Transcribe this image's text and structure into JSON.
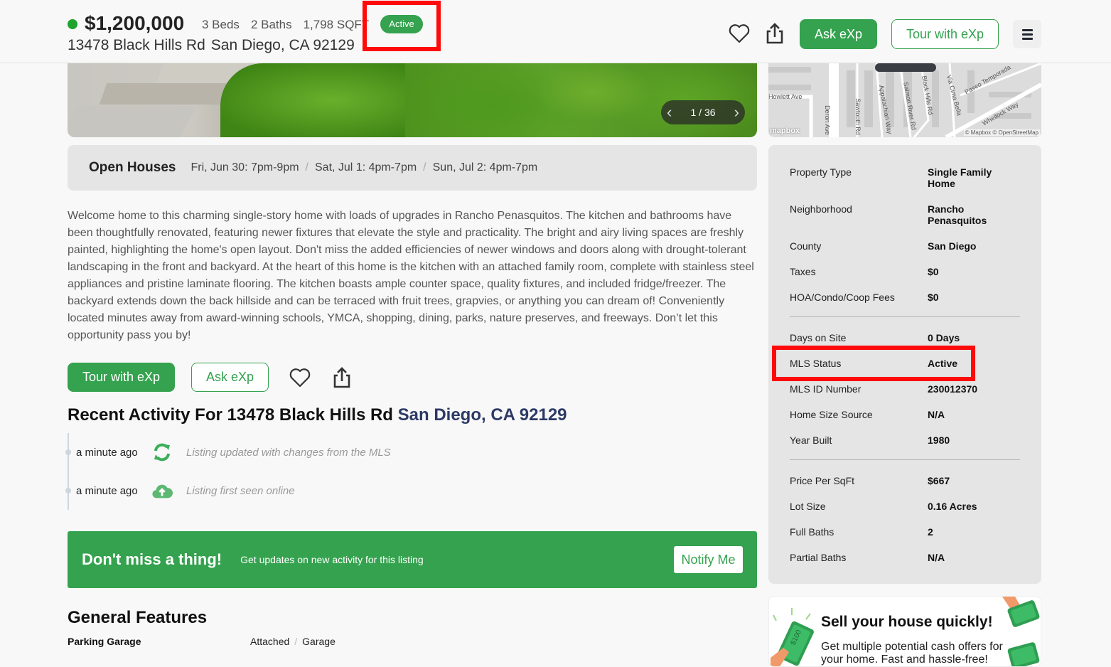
{
  "header": {
    "price": "$1,200,000",
    "beds": "3 Beds",
    "baths": "2 Baths",
    "sqft": "1,798 SQFT",
    "status_badge": "Active",
    "street": "13478 Black Hills Rd",
    "city": "San Diego, CA 92129",
    "actions": {
      "ask_label": "Ask eXp",
      "tour_label": "Tour with eXp",
      "favorite_icon": "heart-icon",
      "share_icon": "share-icon",
      "menu_icon": "hamburger-menu-icon"
    },
    "colors": {
      "brand_green": "#34a24e",
      "status_dot": "#1fa32a",
      "highlight": "#ff0a0a"
    }
  },
  "gallery": {
    "counter": "1 / 36",
    "prev_icon": "chevron-left-icon",
    "next_icon": "chevron-right-icon"
  },
  "map": {
    "labels": [
      "Howlett Ave",
      "Deron Ave",
      "Sawtooth Rd",
      "Appalachian Way",
      "Salmon River Rd",
      "Black Hills Rd",
      "Via Cima Bella",
      "Paseo Temporada",
      "Whellock Way"
    ],
    "logo": "mapbox",
    "attribution": "© Mapbox © OpenStreetMap"
  },
  "open_houses": {
    "title": "Open Houses",
    "slots": [
      "Fri, Jun 30: 7pm-9pm",
      "Sat, Jul 1: 4pm-7pm",
      "Sun, Jul 2: 4pm-7pm"
    ],
    "separator": "/"
  },
  "description": "Welcome home to this charming single-story home with loads of upgrades in Rancho Penasquitos. The kitchen and bathrooms have been thoughtfully renovated, featuring newer fixtures that elevate the style and practicality. The bright and airy living spaces are freshly painted, highlighting the home's open layout. Don't miss the added efficiencies of newer windows and doors along with drought-tolerant landscaping in the front and backyard. At the heart of this home is the kitchen with an attached family room, complete with stainless steel appliances and pristine laminate flooring. The kitchen boasts ample counter space, quality fixtures, and included fridge/freezer. The backyard extends down the back hillside and can be terraced with fruit trees, grapvies, or anything you can dream of! Conveniently located minutes away from award-winning schools, YMCA, shopping, dining, parks, nature preserves, and freeways. Don’t let this opportunity pass you by!",
  "actions_row": {
    "tour_label": "Tour with eXp",
    "ask_label": "Ask eXp"
  },
  "recent_activity": {
    "title_prefix": "Recent Activity For 13478 Black Hills Rd",
    "title_location": "San Diego, CA 92129",
    "items": [
      {
        "time": "a minute ago",
        "icon": "refresh-icon",
        "text": "Listing updated with changes from the MLS"
      },
      {
        "time": "a minute ago",
        "icon": "cloud-upload-icon",
        "text": "Listing first seen online"
      }
    ]
  },
  "notify_banner": {
    "headline": "Don't miss a thing!",
    "subtext": "Get updates on new activity for this listing",
    "button_label": "Notify Me"
  },
  "general_features": {
    "title": "General Features",
    "rows": [
      {
        "label": "Parking Garage",
        "values": [
          "Attached",
          "Garage"
        ]
      }
    ]
  },
  "details": {
    "group1": [
      {
        "label": "Property Type",
        "value": "Single Family Home"
      },
      {
        "label": "Neighborhood",
        "value": "Rancho Penasquitos"
      },
      {
        "label": "County",
        "value": "San Diego"
      },
      {
        "label": "Taxes",
        "value": "$0"
      },
      {
        "label": "HOA/Condo/Coop Fees",
        "value": "$0"
      }
    ],
    "group2": [
      {
        "label": "Days on Site",
        "value": "0 Days"
      },
      {
        "label": "MLS Status",
        "value": "Active"
      },
      {
        "label": "MLS ID Number",
        "value": "230012370"
      },
      {
        "label": "Home Size Source",
        "value": "N/A"
      },
      {
        "label": "Year Built",
        "value": "1980"
      }
    ],
    "group3": [
      {
        "label": "Price Per SqFt",
        "value": "$667"
      },
      {
        "label": "Lot Size",
        "value": "0.16 Acres"
      },
      {
        "label": "Full Baths",
        "value": "2"
      },
      {
        "label": "Partial Baths",
        "value": "N/A"
      }
    ]
  },
  "sell_promo": {
    "title": "Sell your house quickly!",
    "subtitle": "Get multiple potential cash offers for your home. Fast and hassle-free!",
    "bill_label": "$100"
  }
}
